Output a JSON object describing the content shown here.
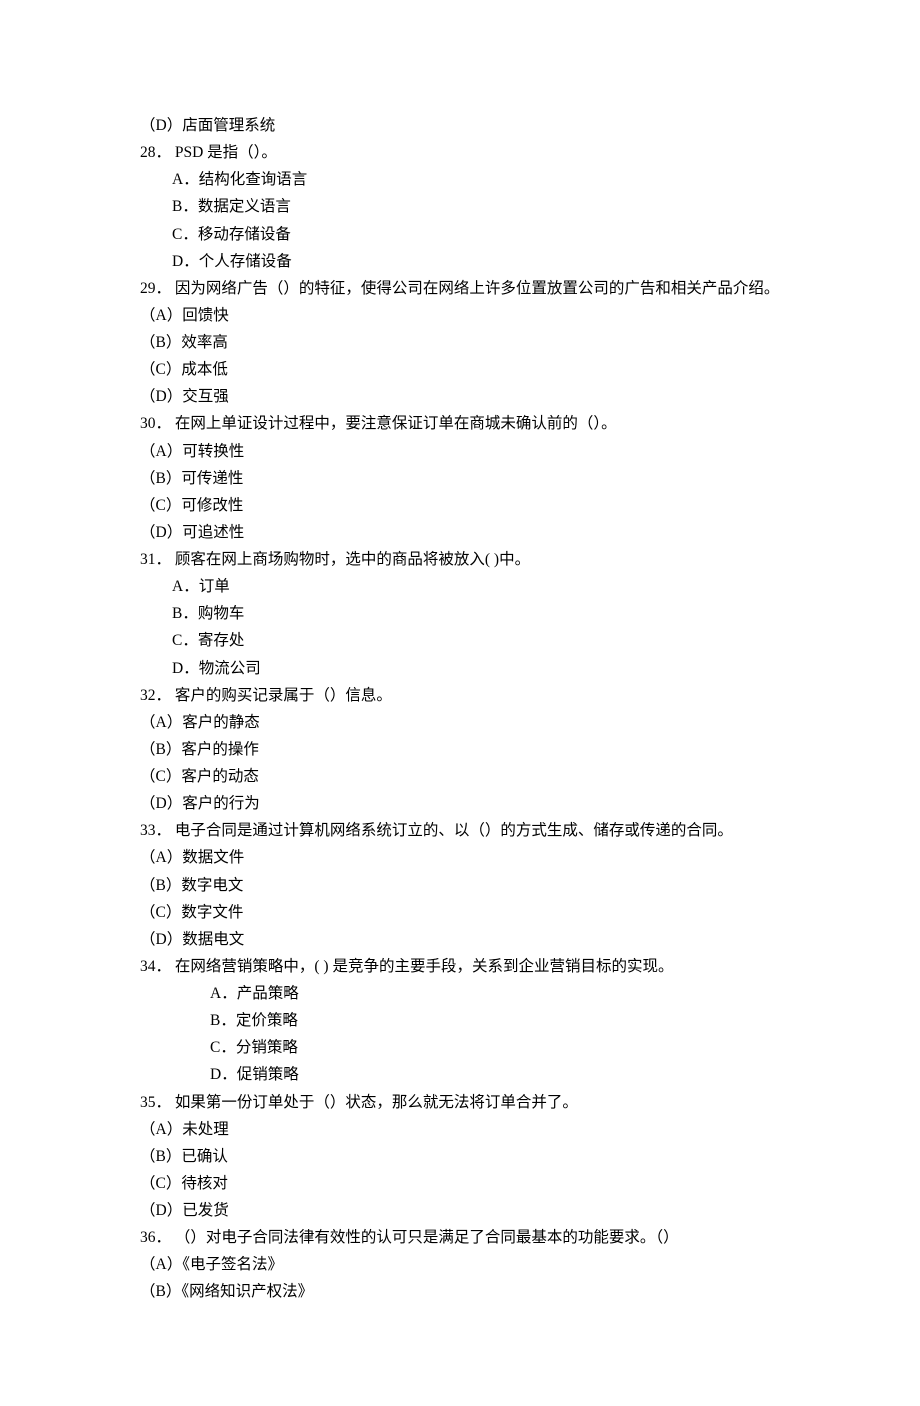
{
  "orphan_opt": "（D）店面管理系统",
  "questions": [
    {
      "num": "28．",
      "stem": "PSD 是指（）。",
      "opt_style": "latin",
      "options": [
        "A．结构化查询语言",
        "B．数据定义语言",
        "C．移动存储设备",
        "D．个人存储设备"
      ]
    },
    {
      "num": "29．",
      "stem": "因为网络广告（）的特征，使得公司在网络上许多位置放置公司的广告和相关产品介绍。",
      "opt_style": "paren",
      "options": [
        "（A）回馈快",
        "（B）效率高",
        "（C）成本低",
        "（D）交互强"
      ]
    },
    {
      "num": "30．",
      "stem": "在网上单证设计过程中，要注意保证订单在商城未确认前的（）。",
      "opt_style": "paren",
      "options": [
        "（A）可转换性",
        "（B）可传递性",
        "（C）可修改性",
        "（D）可追述性"
      ]
    },
    {
      "num": "31．",
      "stem": "顾客在网上商场购物时，选中的商品将被放入(    )中。",
      "opt_style": "latin",
      "options": [
        "A．订单",
        "B．购物车",
        "C．寄存处",
        "D．物流公司"
      ]
    },
    {
      "num": "32．",
      "stem": "客户的购买记录属于（）信息。",
      "opt_style": "paren",
      "options": [
        "（A）客户的静态",
        "（B）客户的操作",
        "（C）客户的动态",
        "（D）客户的行为"
      ]
    },
    {
      "num": "33．",
      "stem": "电子合同是通过计算机网络系统订立的、以（）的方式生成、储存或传递的合同。",
      "opt_style": "paren",
      "options": [
        "（A）数据文件",
        "（B）数字电文",
        "（C）数字文件",
        "（D）数据电文"
      ]
    },
    {
      "num": "34．",
      "stem": "在网络营销策略中，(    ) 是竞争的主要手段，关系到企业营销目标的实现。",
      "opt_style": "mono",
      "options": [
        "A．产品策略",
        "B．定价策略",
        "C．分销策略",
        "D．促销策略"
      ]
    },
    {
      "num": "35．",
      "stem": "如果第一份订单处于（）状态，那么就无法将订单合并了。",
      "opt_style": "paren",
      "options": [
        "（A）未处理",
        "（B）已确认",
        "（C）待核对",
        "（D）已发货"
      ]
    },
    {
      "num": "36．",
      "stem": "（）对电子合同法律有效性的认可只是满足了合同最基本的功能要求。（）",
      "opt_style": "paren",
      "options": [
        "（A）《电子签名法》",
        "（B）《网络知识产权法》"
      ]
    }
  ]
}
